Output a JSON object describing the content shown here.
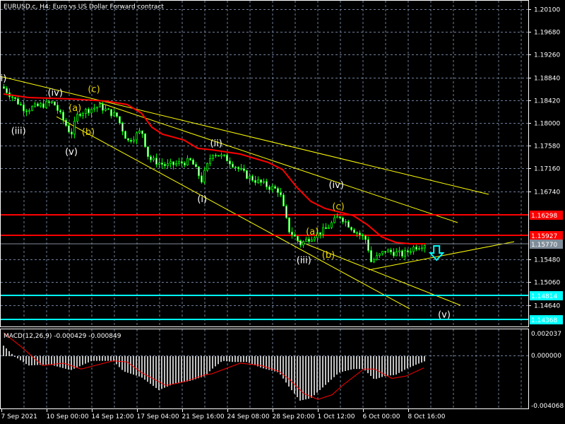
{
  "header": {
    "title": "EURUSD.c, H4:  Euro vs US Dollar Forward contract"
  },
  "macd": {
    "label": "MACD(12,26,9) -0.000429 -0.000849",
    "axis": [
      "0.002037",
      "0.000000",
      "-0.004068"
    ]
  },
  "colors": {
    "background": "#000000",
    "grid": "#6f7f99",
    "bull": "#00ff00",
    "ma": "#ff0000",
    "trendline": "#ffff00",
    "support": "#00ffff",
    "resistance": "#ff0000",
    "current": "#7f8c99",
    "histogram": "#c0c0c0",
    "wave_white": "#ffffff",
    "wave_yellow": "#e6d200"
  },
  "chart_data": {
    "type": "candlestick",
    "title": "EURUSD.c, H4",
    "ylim": [
      1.1414,
      1.2027
    ],
    "y_ticks": [
      "1.20100",
      "1.19680",
      "1.19260",
      "1.18840",
      "1.18420",
      "1.18000",
      "1.17580",
      "1.17160",
      "1.16740",
      "1.15480",
      "1.15060",
      "1.14640"
    ],
    "x_ticks": [
      {
        "bar": -0.75,
        "label": "7 Sep 2021"
      },
      {
        "bar": 15.25,
        "label": "10 Sep 00:00"
      },
      {
        "bar": 31.25,
        "label": "14 Sep 12:00"
      },
      {
        "bar": 47.25,
        "label": "17 Sep 04:00"
      },
      {
        "bar": 63.25,
        "label": "21 Sep 16:00"
      },
      {
        "bar": 79.25,
        "label": "24 Sep 08:00"
      },
      {
        "bar": 95.25,
        "label": "28 Sep 20:00"
      },
      {
        "bar": 111.25,
        "label": "1 Oct 12:00"
      },
      {
        "bar": 127.25,
        "label": "6 Oct 00:00"
      },
      {
        "bar": 143.25,
        "label": "8 Oct 16:00"
      }
    ],
    "bars": 150,
    "close_path": [
      [
        0,
        1.1864
      ],
      [
        3.8,
        1.1844
      ],
      [
        7.5,
        1.1825
      ],
      [
        17.5,
        1.1838
      ],
      [
        23.8,
        1.1779
      ],
      [
        26.3,
        1.1818
      ],
      [
        33.8,
        1.1831
      ],
      [
        40,
        1.1812
      ],
      [
        43.8,
        1.1766
      ],
      [
        48.8,
        1.1786
      ],
      [
        51.3,
        1.1734
      ],
      [
        57.5,
        1.1721
      ],
      [
        66.3,
        1.173
      ],
      [
        70,
        1.1694
      ],
      [
        73.8,
        1.1746
      ],
      [
        78.8,
        1.1734
      ],
      [
        86.3,
        1.1701
      ],
      [
        93.8,
        1.1682
      ],
      [
        97.5,
        1.1675
      ],
      [
        100.8,
        1.1603
      ],
      [
        105,
        1.1577
      ],
      [
        108.8,
        1.159
      ],
      [
        113.8,
        1.1603
      ],
      [
        118.8,
        1.1629
      ],
      [
        123.8,
        1.1603
      ],
      [
        128.3,
        1.1584
      ],
      [
        130,
        1.1544
      ],
      [
        135,
        1.1564
      ],
      [
        141.3,
        1.1557
      ],
      [
        145,
        1.157
      ],
      [
        149,
        1.1577
      ]
    ],
    "moving_average": [
      [
        0,
        1.18535
      ],
      [
        8.8,
        1.1847
      ],
      [
        23.8,
        1.18444
      ],
      [
        36.3,
        1.18404
      ],
      [
        43.8,
        1.18339
      ],
      [
        48.8,
        1.18183
      ],
      [
        52.5,
        1.17922
      ],
      [
        56.3,
        1.17792
      ],
      [
        63.8,
        1.17687
      ],
      [
        68.8,
        1.17531
      ],
      [
        73.8,
        1.17505
      ],
      [
        83.8,
        1.17426
      ],
      [
        93.8,
        1.1727
      ],
      [
        98.8,
        1.17139
      ],
      [
        103.8,
        1.16813
      ],
      [
        108.8,
        1.16552
      ],
      [
        113.8,
        1.16422
      ],
      [
        118.8,
        1.16357
      ],
      [
        123.8,
        1.16291
      ],
      [
        128.8,
        1.16122
      ],
      [
        133.8,
        1.159
      ],
      [
        138.8,
        1.15796
      ],
      [
        143.8,
        1.1577
      ],
      [
        149.5,
        1.1577
      ]
    ],
    "horizontal_levels": [
      {
        "price": 1.16298,
        "label": "1.16298",
        "kind": "resistance"
      },
      {
        "price": 1.15927,
        "label": "1.15927",
        "kind": "resistance"
      },
      {
        "price": 1.1577,
        "label": "1.15770",
        "kind": "current"
      },
      {
        "price": 1.14814,
        "label": "1.14814",
        "kind": "support"
      },
      {
        "price": 1.14368,
        "label": "1.14368",
        "kind": "support"
      }
    ],
    "trendlines": [
      [
        [
          -1.25,
          1.18861
        ],
        [
          171.75,
          1.16683
        ]
      ],
      [
        [
          33.75,
          1.18378
        ],
        [
          160.75,
          1.16161
        ]
      ],
      [
        [
          18.75,
          1.18117
        ],
        [
          143.75,
          1.1457
        ]
      ],
      [
        [
          103.75,
          1.15835
        ],
        [
          161.75,
          1.14635
        ]
      ],
      [
        [
          129.25,
          1.15287
        ],
        [
          180.75,
          1.15809
        ]
      ]
    ],
    "wave_labels": [
      {
        "text": "i)",
        "bar": 0,
        "price": 1.1877,
        "color": "white"
      },
      {
        "text": "(iv)",
        "bar": 18.3,
        "price": 1.185,
        "color": "white"
      },
      {
        "text": "(iii)",
        "bar": 5.3,
        "price": 1.178,
        "color": "white"
      },
      {
        "text": "(v)",
        "bar": 24,
        "price": 1.1741,
        "color": "white"
      },
      {
        "text": "(a)",
        "bar": 25.3,
        "price": 1.1822,
        "color": "yellow"
      },
      {
        "text": "(b)",
        "bar": 30,
        "price": 1.1778,
        "color": "yellow"
      },
      {
        "text": "(c)",
        "bar": 32,
        "price": 1.1857,
        "color": "yellow"
      },
      {
        "text": "(ii)",
        "bar": 75.3,
        "price": 1.1757,
        "color": "white"
      },
      {
        "text": "(i)",
        "bar": 70.3,
        "price": 1.1654,
        "color": "white"
      },
      {
        "text": "(iv)",
        "bar": 117.8,
        "price": 1.168,
        "color": "white"
      },
      {
        "text": "(c)",
        "bar": 118.5,
        "price": 1.164,
        "color": "yellow"
      },
      {
        "text": "(a)",
        "bar": 109.3,
        "price": 1.1594,
        "color": "yellow"
      },
      {
        "text": "(b)",
        "bar": 115,
        "price": 1.1551,
        "color": "yellow"
      },
      {
        "text": "(iii)",
        "bar": 106.3,
        "price": 1.1541,
        "color": "white"
      },
      {
        "text": "(v)",
        "bar": 156,
        "price": 1.1441,
        "color": "white"
      }
    ],
    "signal_arrow": {
      "direction": "down",
      "bar": 153.3,
      "price": 1.156
    },
    "macd_ylim": [
      -0.004068,
      0.002037
    ],
    "macd_histogram": [
      [
        0,
        0.0009
      ],
      [
        3.8,
        0
      ],
      [
        8.8,
        -0.0008
      ],
      [
        16.3,
        -0.0007
      ],
      [
        23.8,
        -0.0012
      ],
      [
        31.3,
        -0.0004
      ],
      [
        38.8,
        -0.0004
      ],
      [
        42.5,
        -0.0013
      ],
      [
        48.8,
        -0.0018
      ],
      [
        55,
        -0.0029
      ],
      [
        60,
        -0.0024
      ],
      [
        66.3,
        -0.0021
      ],
      [
        71.3,
        -0.0017
      ],
      [
        73.8,
        -0.0011
      ],
      [
        77.5,
        -0.0004
      ],
      [
        81.3,
        -0.0005
      ],
      [
        86.3,
        -0.0005
      ],
      [
        91.3,
        -0.001
      ],
      [
        97.5,
        -0.0014
      ],
      [
        101.3,
        -0.0027
      ],
      [
        105,
        -0.0038
      ],
      [
        108.8,
        -0.0036
      ],
      [
        113.8,
        -0.0025
      ],
      [
        118.8,
        -0.0014
      ],
      [
        123.8,
        -0.0011
      ],
      [
        127.5,
        -0.0011
      ],
      [
        131.3,
        -0.002
      ],
      [
        135,
        -0.0017
      ],
      [
        138.8,
        -0.0016
      ],
      [
        142.5,
        -0.0011
      ],
      [
        146.3,
        -0.0007
      ],
      [
        149.5,
        -0.0004
      ]
    ],
    "macd_signal": [
      [
        0,
        0.002
      ],
      [
        6.3,
        0.0008
      ],
      [
        13.8,
        -0.0008
      ],
      [
        21.3,
        -0.0006
      ],
      [
        27.5,
        -0.0011
      ],
      [
        38.8,
        -0.0004
      ],
      [
        43.8,
        -0.0005
      ],
      [
        48.8,
        -0.0014
      ],
      [
        57.5,
        -0.0025
      ],
      [
        63.8,
        -0.0022
      ],
      [
        71.3,
        -0.0016
      ],
      [
        73.8,
        -0.0015
      ],
      [
        83.8,
        -0.0006
      ],
      [
        91.3,
        -0.0008
      ],
      [
        97.5,
        -0.0013
      ],
      [
        101.3,
        -0.002
      ],
      [
        106.3,
        -0.0032
      ],
      [
        111.3,
        -0.0037
      ],
      [
        116.3,
        -0.0033
      ],
      [
        120,
        -0.0025
      ],
      [
        127.5,
        -0.0011
      ],
      [
        131.3,
        -0.0011
      ],
      [
        137.5,
        -0.0019
      ],
      [
        142.5,
        -0.0017
      ],
      [
        148.8,
        -0.001
      ]
    ]
  }
}
